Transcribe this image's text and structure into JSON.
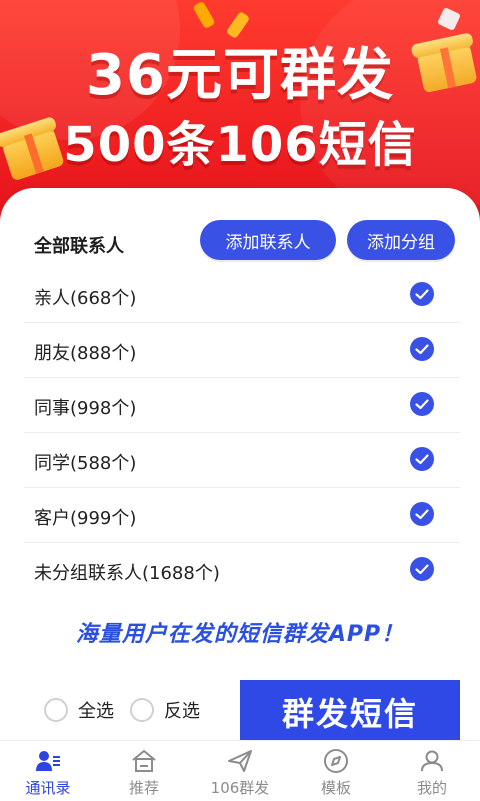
{
  "banner": {
    "line1": "36元可群发",
    "line2": "500条106短信"
  },
  "contacts": {
    "all_label": "全部联系人",
    "add_contact_label": "添加联系人",
    "add_group_label": "添加分组",
    "groups": [
      {
        "label": "亲人(668个)",
        "checked": true
      },
      {
        "label": "朋友(888个)",
        "checked": true
      },
      {
        "label": "同事(998个)",
        "checked": true
      },
      {
        "label": "同学(588个)",
        "checked": true
      },
      {
        "label": "客户(999个)",
        "checked": true
      },
      {
        "label": "未分组联系人(1688个)",
        "checked": true
      }
    ]
  },
  "tagline": "海量用户在发的短信群发APP！",
  "actions": {
    "select_all_label": "全选",
    "invert_select_label": "反选",
    "send_label": "群发短信"
  },
  "nav": {
    "items": [
      {
        "label": "通讯录",
        "icon": "contacts-icon",
        "active": true
      },
      {
        "label": "推荐",
        "icon": "home-icon",
        "active": false
      },
      {
        "label": "106群发",
        "icon": "send-icon",
        "active": false
      },
      {
        "label": "模板",
        "icon": "compass-icon",
        "active": false
      },
      {
        "label": "我的",
        "icon": "user-icon",
        "active": false
      }
    ]
  },
  "colors": {
    "accent": "#3a51e6",
    "banner_red": "#ef1f22",
    "text": "#222222",
    "inactive": "#8c8c8c"
  }
}
